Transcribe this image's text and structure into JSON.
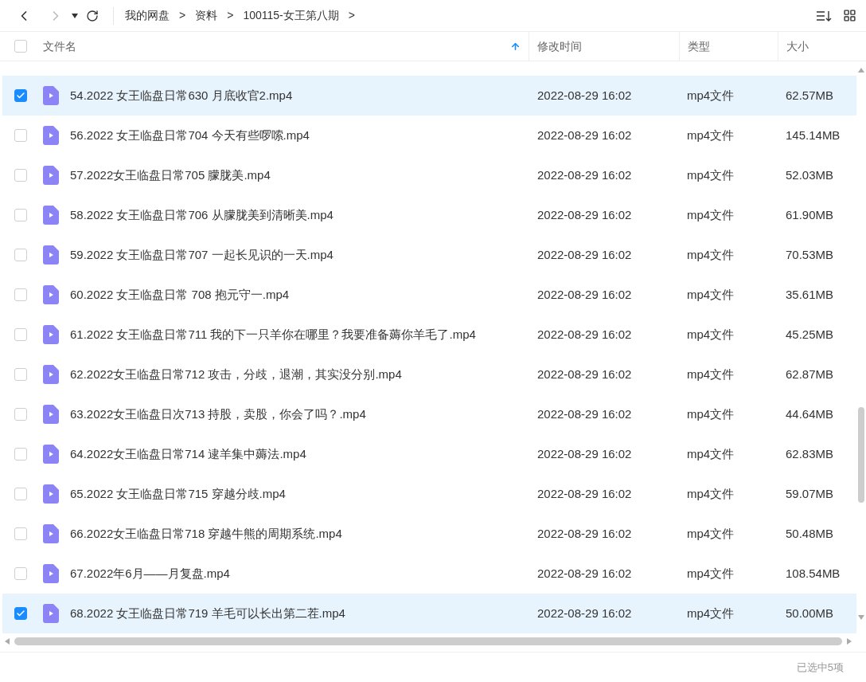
{
  "breadcrumb": [
    "我的网盘",
    "资料",
    "100115-女王第八期"
  ],
  "breadcrumb_separator": ">",
  "columns": [
    {
      "label": "文件名",
      "sorted": true
    },
    {
      "label": "修改时间",
      "sorted": false
    },
    {
      "label": "类型",
      "sorted": false
    },
    {
      "label": "大小",
      "sorted": false
    }
  ],
  "header_checked": false,
  "rows": [
    {
      "name": "54.2022 女王临盘日常630 月底收官2.mp4",
      "modified": "2022-08-29 16:02",
      "type": "mp4文件",
      "size": "62.57MB",
      "selected": true
    },
    {
      "name": "56.2022 女王临盘日常704 今天有些啰嗦.mp4",
      "modified": "2022-08-29 16:02",
      "type": "mp4文件",
      "size": "145.14MB",
      "selected": false
    },
    {
      "name": "57.2022女王临盘日常705 朦胧美.mp4",
      "modified": "2022-08-29 16:02",
      "type": "mp4文件",
      "size": "52.03MB",
      "selected": false
    },
    {
      "name": "58.2022 女王临盘日常706 从朦胧美到清晰美.mp4",
      "modified": "2022-08-29 16:02",
      "type": "mp4文件",
      "size": "61.90MB",
      "selected": false
    },
    {
      "name": "59.2022 女王临盘日常707 一起长见识的一天.mp4",
      "modified": "2022-08-29 16:02",
      "type": "mp4文件",
      "size": "70.53MB",
      "selected": false
    },
    {
      "name": "60.2022 女王临盘日常 708 抱元守一.mp4",
      "modified": "2022-08-29 16:02",
      "type": "mp4文件",
      "size": "35.61MB",
      "selected": false
    },
    {
      "name": "61.2022 女王临盘日常711 我的下一只羊你在哪里？我要准备薅你羊毛了.mp4",
      "modified": "2022-08-29 16:02",
      "type": "mp4文件",
      "size": "45.25MB",
      "selected": false
    },
    {
      "name": "62.2022女王临盘日常712 攻击，分歧，退潮，其实没分别.mp4",
      "modified": "2022-08-29 16:02",
      "type": "mp4文件",
      "size": "62.87MB",
      "selected": false
    },
    {
      "name": "63.2022女王临盘日次713 持股，卖股，你会了吗？.mp4",
      "modified": "2022-08-29 16:02",
      "type": "mp4文件",
      "size": "44.64MB",
      "selected": false
    },
    {
      "name": "64.2022女王临盘日常714 逮羊集中薅法.mp4",
      "modified": "2022-08-29 16:02",
      "type": "mp4文件",
      "size": "62.83MB",
      "selected": false
    },
    {
      "name": "65.2022 女王临盘日常715 穿越分歧.mp4",
      "modified": "2022-08-29 16:02",
      "type": "mp4文件",
      "size": "59.07MB",
      "selected": false
    },
    {
      "name": "66.2022女王临盘日常718 穿越牛熊的周期系统.mp4",
      "modified": "2022-08-29 16:02",
      "type": "mp4文件",
      "size": "50.48MB",
      "selected": false
    },
    {
      "name": "67.2022年6月——月复盘.mp4",
      "modified": "2022-08-29 16:02",
      "type": "mp4文件",
      "size": "108.54MB",
      "selected": false
    },
    {
      "name": "68.2022 女王临盘日常719 羊毛可以长出第二茬.mp4",
      "modified": "2022-08-29 16:02",
      "type": "mp4文件",
      "size": "50.00MB",
      "selected": true
    }
  ],
  "status": "已选中5项"
}
